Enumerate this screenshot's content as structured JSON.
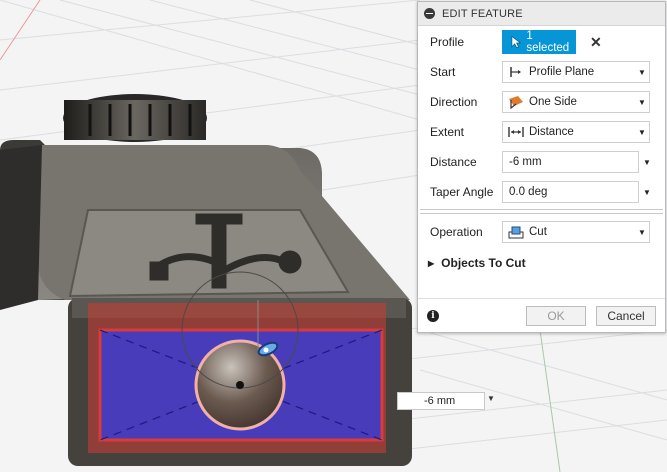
{
  "dialog": {
    "title": "EDIT FEATURE",
    "rows": {
      "profile": {
        "label": "Profile",
        "value": "1 selected"
      },
      "start": {
        "label": "Start",
        "value": "Profile Plane"
      },
      "direction": {
        "label": "Direction",
        "value": "One Side"
      },
      "extent": {
        "label": "Extent",
        "value": "Distance"
      },
      "distance": {
        "label": "Distance",
        "value": "-6 mm"
      },
      "taper": {
        "label": "Taper Angle",
        "value": "0.0 deg"
      },
      "operation": {
        "label": "Operation",
        "value": "Cut"
      }
    },
    "objects_to_cut": "Objects To Cut",
    "ok_label": "OK",
    "cancel_label": "Cancel"
  },
  "viewport": {
    "distance_field": "-6 mm"
  },
  "colors": {
    "accent": "#0696d7",
    "cut_red": "#d93a3a",
    "profile_blue": "#3c3cc8"
  }
}
